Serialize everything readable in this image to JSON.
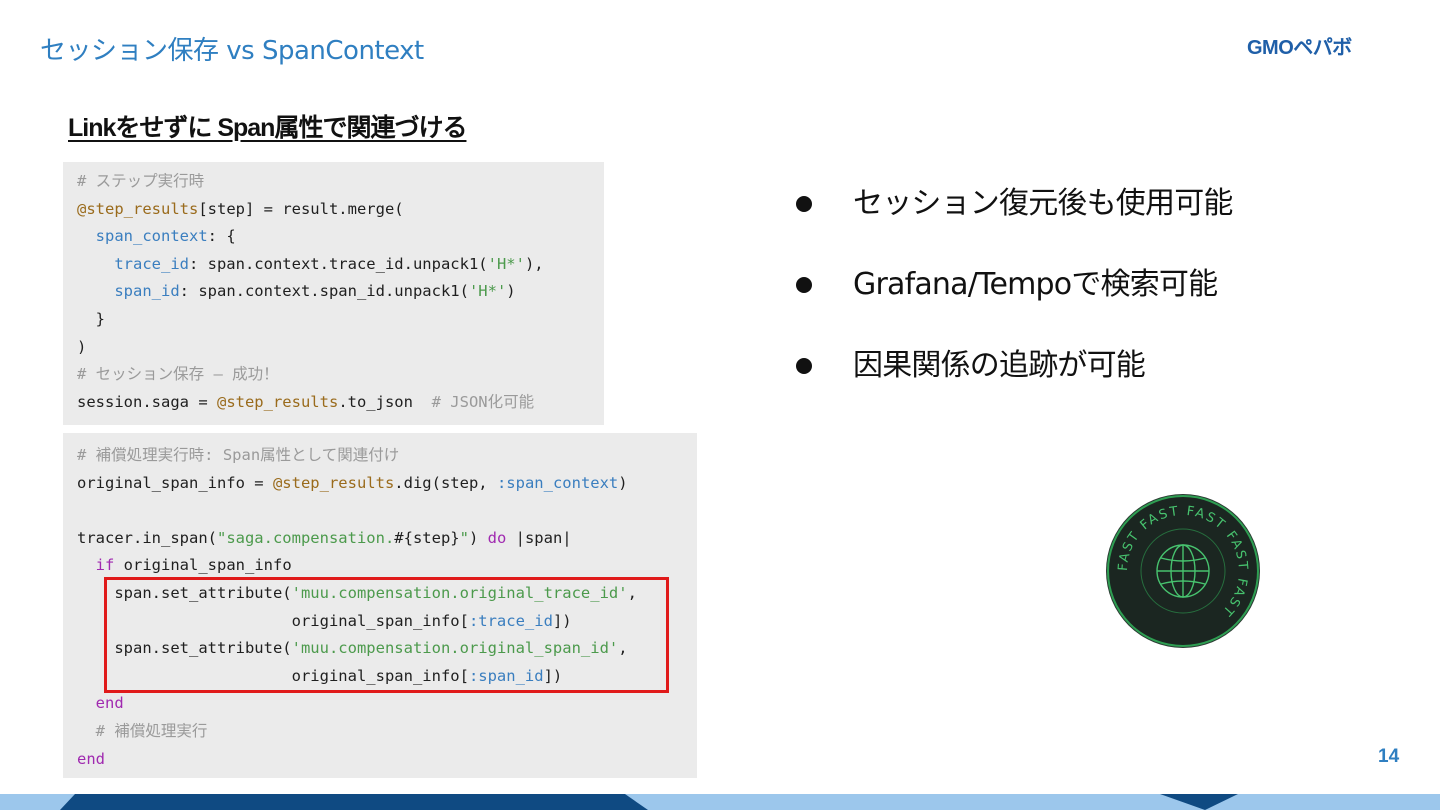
{
  "header": {
    "title": "セッション保存 vs SpanContext",
    "logo_text": "GMOペパボ"
  },
  "subheading": "Linkをせずに Span属性で関連づける",
  "code_block_1": [
    [
      {
        "t": "# ステップ実行時",
        "c": "comment"
      }
    ],
    [
      {
        "t": "@step_results",
        "c": "ivar"
      },
      {
        "t": "[step] = result.merge(",
        "c": ""
      }
    ],
    [
      {
        "t": "  ",
        "c": ""
      },
      {
        "t": "span_context",
        "c": "key"
      },
      {
        "t": ": {",
        "c": ""
      }
    ],
    [
      {
        "t": "    ",
        "c": ""
      },
      {
        "t": "trace_id",
        "c": "key"
      },
      {
        "t": ": span.context.trace_id.unpack1(",
        "c": ""
      },
      {
        "t": "'H*'",
        "c": "str"
      },
      {
        "t": "),",
        "c": ""
      }
    ],
    [
      {
        "t": "    ",
        "c": ""
      },
      {
        "t": "span_id",
        "c": "key"
      },
      {
        "t": ": span.context.span_id.unpack1(",
        "c": ""
      },
      {
        "t": "'H*'",
        "c": "str"
      },
      {
        "t": ")",
        "c": ""
      }
    ],
    [
      {
        "t": "  }",
        "c": ""
      }
    ],
    [
      {
        "t": ")",
        "c": ""
      }
    ],
    [
      {
        "t": "# セッション保存 – 成功！",
        "c": "comment"
      }
    ],
    [
      {
        "t": "session.saga = ",
        "c": ""
      },
      {
        "t": "@step_results",
        "c": "ivar"
      },
      {
        "t": ".to_json  ",
        "c": ""
      },
      {
        "t": "# JSON化可能",
        "c": "comment"
      }
    ]
  ],
  "code_block_2": [
    [
      {
        "t": "# 補償処理実行時: Span属性として関連付け",
        "c": "comment"
      }
    ],
    [
      {
        "t": "original_span_info = ",
        "c": ""
      },
      {
        "t": "@step_results",
        "c": "ivar"
      },
      {
        "t": ".dig(step, ",
        "c": ""
      },
      {
        "t": ":span_context",
        "c": "sym"
      },
      {
        "t": ")",
        "c": ""
      }
    ],
    [
      {
        "t": "",
        "c": ""
      }
    ],
    [
      {
        "t": "tracer.in_span(",
        "c": ""
      },
      {
        "t": "\"saga.compensation.",
        "c": "str"
      },
      {
        "t": "#{step}",
        "c": ""
      },
      {
        "t": "\"",
        "c": "str"
      },
      {
        "t": ") ",
        "c": ""
      },
      {
        "t": "do",
        "c": "kw"
      },
      {
        "t": " |span|",
        "c": ""
      }
    ],
    [
      {
        "t": "  ",
        "c": ""
      },
      {
        "t": "if",
        "c": "kw"
      },
      {
        "t": " original_span_info",
        "c": ""
      }
    ],
    [
      {
        "t": "    span.set_attribute(",
        "c": ""
      },
      {
        "t": "'muu.compensation.original_trace_id'",
        "c": "str"
      },
      {
        "t": ",",
        "c": ""
      }
    ],
    [
      {
        "t": "                       original_span_info[",
        "c": ""
      },
      {
        "t": ":trace_id",
        "c": "sym"
      },
      {
        "t": "])",
        "c": ""
      }
    ],
    [
      {
        "t": "    span.set_attribute(",
        "c": ""
      },
      {
        "t": "'muu.compensation.original_span_id'",
        "c": "str"
      },
      {
        "t": ",",
        "c": ""
      }
    ],
    [
      {
        "t": "                       original_span_info[",
        "c": ""
      },
      {
        "t": ":span_id",
        "c": "sym"
      },
      {
        "t": "])",
        "c": ""
      }
    ],
    [
      {
        "t": "  ",
        "c": ""
      },
      {
        "t": "end",
        "c": "kw"
      }
    ],
    [
      {
        "t": "  ",
        "c": ""
      },
      {
        "t": "# 補償処理実行",
        "c": "comment"
      }
    ],
    [
      {
        "t": "end",
        "c": "kw"
      }
    ]
  ],
  "bullets": [
    "セッション復元後も使用可能",
    "Grafana/Tempoで検索可能",
    "因果関係の追跡が可能"
  ],
  "badge": {
    "ring_text": "FAST FAST FAST FAST FAST",
    "icon": "globe-icon",
    "colors": {
      "fill": "#1d2b24",
      "ring": "#2e9e52",
      "text": "#47c26e"
    }
  },
  "page_number": "14",
  "colors": {
    "accent": "#2f7fc1",
    "highlight": "#e01a1a",
    "footer_dark": "#0f4a82",
    "footer_light": "#9cc7ec"
  }
}
